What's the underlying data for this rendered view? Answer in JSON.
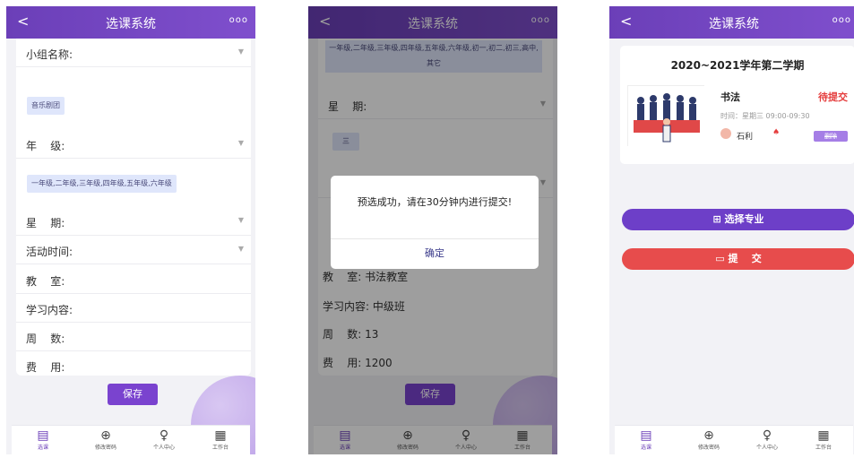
{
  "app_title": "选课系统",
  "back_icon": "<",
  "more_icon": "ooo",
  "tabs": [
    {
      "label": "选课",
      "icon": "file"
    },
    {
      "label": "修改密码",
      "icon": "lock"
    },
    {
      "label": "个人中心",
      "icon": "person"
    },
    {
      "label": "工作台",
      "icon": "grid"
    }
  ],
  "form": {
    "group_label": "小组名称:",
    "group_value": "音乐剧团",
    "grade_label": "年    级:",
    "grade_value": "一年级,二年级,三年级,四年级,五年级,六年级",
    "week_label": "星    期:",
    "time_label": "活动时间:",
    "room_label": "教    室:",
    "content_label": "学习内容:",
    "weeks_label": "周    数:",
    "fee_label": "费    用:",
    "save_label": "保存"
  },
  "modal_screen": {
    "grade_value": "一年级,二年级,三年级,四年级,五年级,六年级,初一,初二,初三,高中,其它",
    "week_label": "星    期:",
    "week_value": "三",
    "room": "教    室: 书法教室",
    "content": "学习内容: 中级班",
    "weeks": "周    数: 13",
    "fee": "费    用: 1200",
    "save_label": "保存",
    "dialog_message": "预选成功，请在30分钟内进行提交!",
    "dialog_ok": "确定"
  },
  "course_screen": {
    "term": "2020~2021学年第二学期",
    "course_name": "书法",
    "status": "待提交",
    "time": "时间：星期三 09:00-09:30",
    "teacher": "石利",
    "delete_label": "删除",
    "select_major_label": "选择专业",
    "submit_label": "提    交"
  },
  "colors": {
    "header": "#6b3fb8",
    "primary_button": "#7a43cf",
    "status_red": "#e53e3e",
    "submit_red": "#e74c4c"
  }
}
